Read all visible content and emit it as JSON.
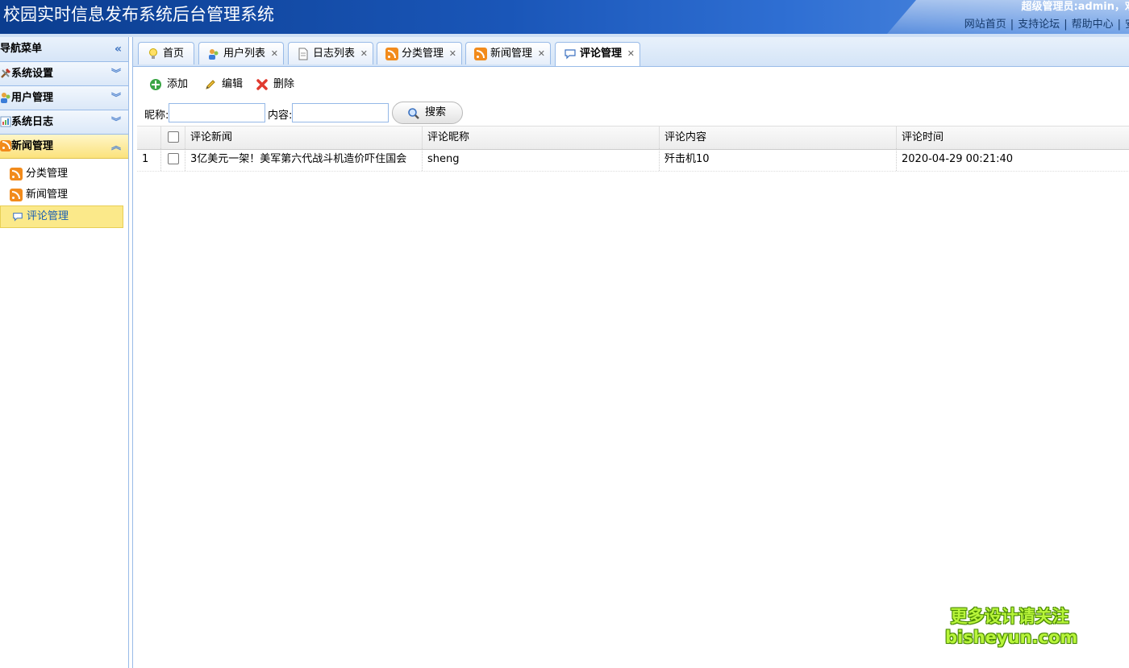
{
  "header": {
    "title": "校园实时信息发布系统后台管理系统",
    "user": "超级管理员:admin，欢",
    "links": [
      "网站首页",
      "支持论坛",
      "帮助中心",
      "安"
    ]
  },
  "sidebar": {
    "title": "导航菜单",
    "collapse_glyph": "«",
    "sections": [
      {
        "label": "系统设置",
        "expanded": false
      },
      {
        "label": "用户管理",
        "expanded": false
      },
      {
        "label": "系统日志",
        "expanded": false
      },
      {
        "label": "新闻管理",
        "expanded": true
      }
    ],
    "sub_items": [
      {
        "label": "分类管理"
      },
      {
        "label": "新闻管理"
      },
      {
        "label": "评论管理",
        "selected": true
      }
    ]
  },
  "tabs": [
    {
      "label": "首页",
      "icon": "lightbulb-icon",
      "closable": false
    },
    {
      "label": "用户列表",
      "icon": "users-icon",
      "closable": true
    },
    {
      "label": "日志列表",
      "icon": "document-icon",
      "closable": true
    },
    {
      "label": "分类管理",
      "icon": "rss-icon",
      "closable": true
    },
    {
      "label": "新闻管理",
      "icon": "rss-icon",
      "closable": true
    },
    {
      "label": "评论管理",
      "icon": "comment-icon",
      "closable": true,
      "active": true
    }
  ],
  "toolbar": {
    "add_label": "添加",
    "edit_label": "编辑",
    "delete_label": "删除"
  },
  "search": {
    "nickname_label": "昵称:",
    "content_label": "内容:",
    "nickname_value": "",
    "content_value": "",
    "button_label": "搜索"
  },
  "grid": {
    "columns": [
      "评论新闻",
      "评论昵称",
      "评论内容",
      "评论时间"
    ],
    "rows": [
      {
        "index": "1",
        "news": "3亿美元一架！美军第六代战斗机造价吓住国会",
        "nickname": "sheng",
        "content": "歼击机10",
        "time": "2020-04-29 00:21:40"
      }
    ]
  },
  "watermark": {
    "line1": "更多设计请关注",
    "line2": "bisheyun.com"
  },
  "colors": {
    "header_blue": "#1a56b8",
    "panel_border": "#99bbe8",
    "selected_yellow": "#fbe98a",
    "rss_orange": "#f28b1c"
  }
}
